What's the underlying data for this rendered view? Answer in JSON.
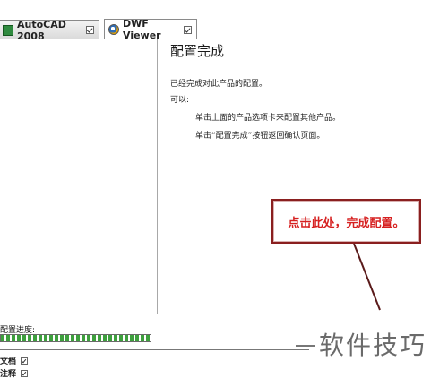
{
  "tabs": [
    {
      "label": "AutoCAD 2008",
      "icon": "autocad-icon",
      "active": false
    },
    {
      "label": "DWF Viewer",
      "icon": "dwf-viewer-icon",
      "active": true
    }
  ],
  "main": {
    "title": "配置完成",
    "lines": [
      "已经完成对此产品的配置。",
      "可以:",
      "单击上面的产品选项卡来配置其他产品。",
      "单击“配置完成”按钮返回确认页面。"
    ]
  },
  "annotation": {
    "text": "点击此处，完成配置。",
    "color": "#d62020",
    "border_color": "#8a1f1f"
  },
  "progress": {
    "label": "配置进度:",
    "value_fraction": 1.0,
    "color": "#3ea03e"
  },
  "list": [
    {
      "label": "文档"
    },
    {
      "label": "注释"
    }
  ],
  "watermark": "软件技巧"
}
